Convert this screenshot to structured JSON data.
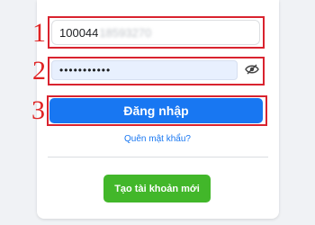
{
  "steps": [
    "1",
    "2",
    "3"
  ],
  "login_form": {
    "phone_prefix": "100044",
    "phone_masked": "18593270",
    "password_dots": "•••••••••••",
    "password_toggle_icon": "eye-slash-icon",
    "login_label": "Đăng nhập",
    "forgot_label": "Quên mật khẩu?",
    "create_label": "Tạo tài khoản mới"
  },
  "colors": {
    "primary": "#1877f2",
    "create": "#42b72a",
    "highlight": "#d9232f"
  }
}
